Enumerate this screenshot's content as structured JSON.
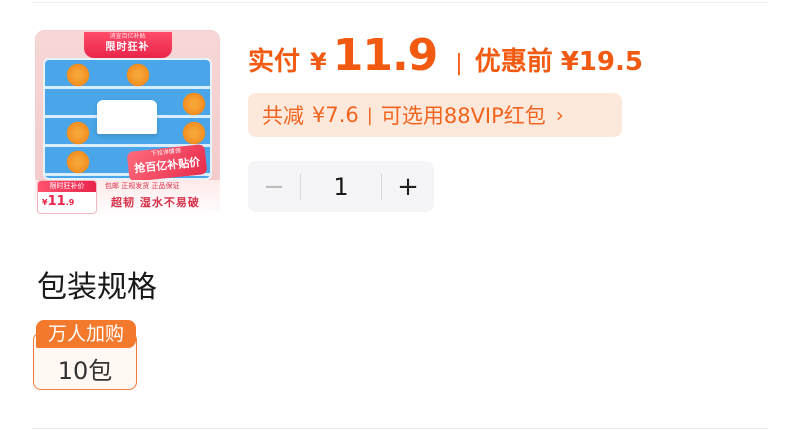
{
  "product_image": {
    "banner_small": "消宣百亿补贴",
    "banner_big": "限时狂补",
    "promo_small": "下拉详情领",
    "promo_big": "抢百亿补贴价",
    "guarantee": "包邮 正规发货 正品保证",
    "price_badge_label": "限时狂补价",
    "price_badge_currency": "¥",
    "price_badge_value": "11",
    "price_badge_decimal": ".9",
    "feature": "超韧 湿水不易破"
  },
  "price": {
    "pay_label": "实付",
    "currency": "¥",
    "amount": "11.9",
    "separator": "|",
    "original_label": "优惠前",
    "original_value": "¥19.5"
  },
  "discount": {
    "reduce_label": "共减",
    "reduce_value": "¥7.6",
    "separator": "|",
    "coupon_text": "可选用88VIP红包",
    "chevron": "›"
  },
  "quantity": {
    "minus": "−",
    "value": "1",
    "plus": "+"
  },
  "spec": {
    "title": "包装规格",
    "options": [
      {
        "tag": "万人加购",
        "value": "10包"
      }
    ]
  },
  "colors": {
    "accent": "#f25a12",
    "pill_bg": "#fde9dc",
    "option_border": "#f27a3a"
  }
}
